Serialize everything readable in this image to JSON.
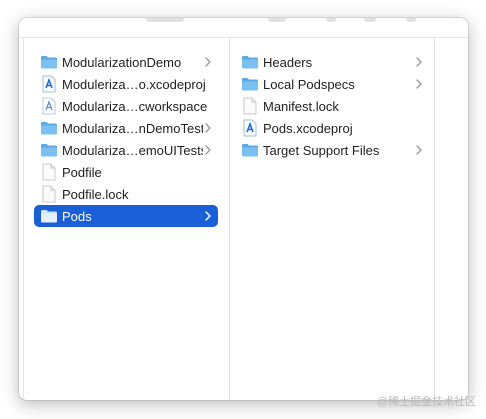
{
  "colors": {
    "selection": "#1a5fd6",
    "folder": "#5aa9e6",
    "text": "#222222"
  },
  "column1": {
    "items": [
      {
        "label": "ModularizationDemo",
        "icon": "folder-icon",
        "has_children": true,
        "selected": false
      },
      {
        "label": "Moduleriza…o.xcodeproj",
        "icon": "xcodeproj-icon",
        "has_children": false,
        "selected": false
      },
      {
        "label": "Modulariza…cworkspace",
        "icon": "xcworkspace-icon",
        "has_children": false,
        "selected": false
      },
      {
        "label": "Modulariza…nDemoTests",
        "icon": "folder-icon",
        "has_children": true,
        "selected": false
      },
      {
        "label": "Modulariza…emoUITests",
        "icon": "folder-icon",
        "has_children": true,
        "selected": false
      },
      {
        "label": "Podfile",
        "icon": "file-icon",
        "has_children": false,
        "selected": false
      },
      {
        "label": "Podfile.lock",
        "icon": "file-icon",
        "has_children": false,
        "selected": false
      },
      {
        "label": "Pods",
        "icon": "folder-icon",
        "has_children": true,
        "selected": true
      }
    ]
  },
  "column2": {
    "items": [
      {
        "label": "Headers",
        "icon": "folder-icon",
        "has_children": true
      },
      {
        "label": "Local Podspecs",
        "icon": "folder-icon",
        "has_children": true
      },
      {
        "label": "Manifest.lock",
        "icon": "file-icon",
        "has_children": false
      },
      {
        "label": "Pods.xcodeproj",
        "icon": "xcodeproj-icon",
        "has_children": false
      },
      {
        "label": "Target Support Files",
        "icon": "folder-icon",
        "has_children": true
      }
    ]
  },
  "watermark": "@稀土掘金技术社区"
}
